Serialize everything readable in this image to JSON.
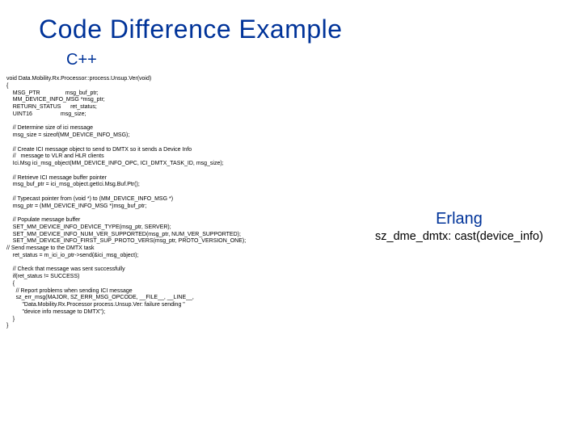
{
  "title": "Code Difference Example",
  "cpp": {
    "heading": "C++",
    "code": "void Data.Mobility.Rx.Processor::process.Unsup.Ver(void)\n{\n    MSG_PTR                msg_buf_ptr;\n    MM_DEVICE_INFO_MSG *msg_ptr;\n    RETURN_STATUS      ret_status;\n    UINT16                  msg_size;\n\n    // Determine size of ici message\n    msg_size = sizeof(MM_DEVICE_INFO_MSG);\n\n    // Create ICI message object to send to DMTX so it sends a Device Info\n    //   message to VLR and HLR clients\n    Ici.Msg ici_msg_object(MM_DEVICE_INFO_OPC, ICI_DMTX_TASK_ID, msg_size);\n\n    // Retrieve ICI message buffer pointer\n    msg_buf_ptr = ici_msg_object.getIci.Msg.Buf.Ptr();\n\n    // Typecast pointer from (void *) to (MM_DEVICE_INFO_MSG *)\n    msg_ptr = (MM_DEVICE_INFO_MSG *)msg_buf_ptr;\n\n    // Populate message buffer\n    SET_MM_DEVICE_INFO_DEVICE_TYPE(msg_ptr, SERVER);\n    SET_MM_DEVICE_INFO_NUM_VER_SUPPORTED(msg_ptr, NUM_VER_SUPPORTED);\n    SET_MM_DEVICE_INFO_FIRST_SUP_PROTO_VERS(msg_ptr, PROTO_VERSION_ONE);\n// Send message to the DMTX task\n    ret_status = m_ici_io_ptr->send(&ici_msg_object);\n\n    // Check that message was sent successfully\n    if(ret_status != SUCCESS)\n    {\n      // Report problems when sending ICI message\n      sz_err_msg(MAJOR, SZ_ERR_MSG_OPCODE, __FILE__, __LINE__,\n          \"Data.Mobility.Rx.Processor process.Unsup.Ver: failure sending \"\n          \"device info message to DMTX\");\n    }\n}"
  },
  "erlang": {
    "heading": "Erlang",
    "code": "sz_dme_dmtx: cast(device_info)"
  }
}
